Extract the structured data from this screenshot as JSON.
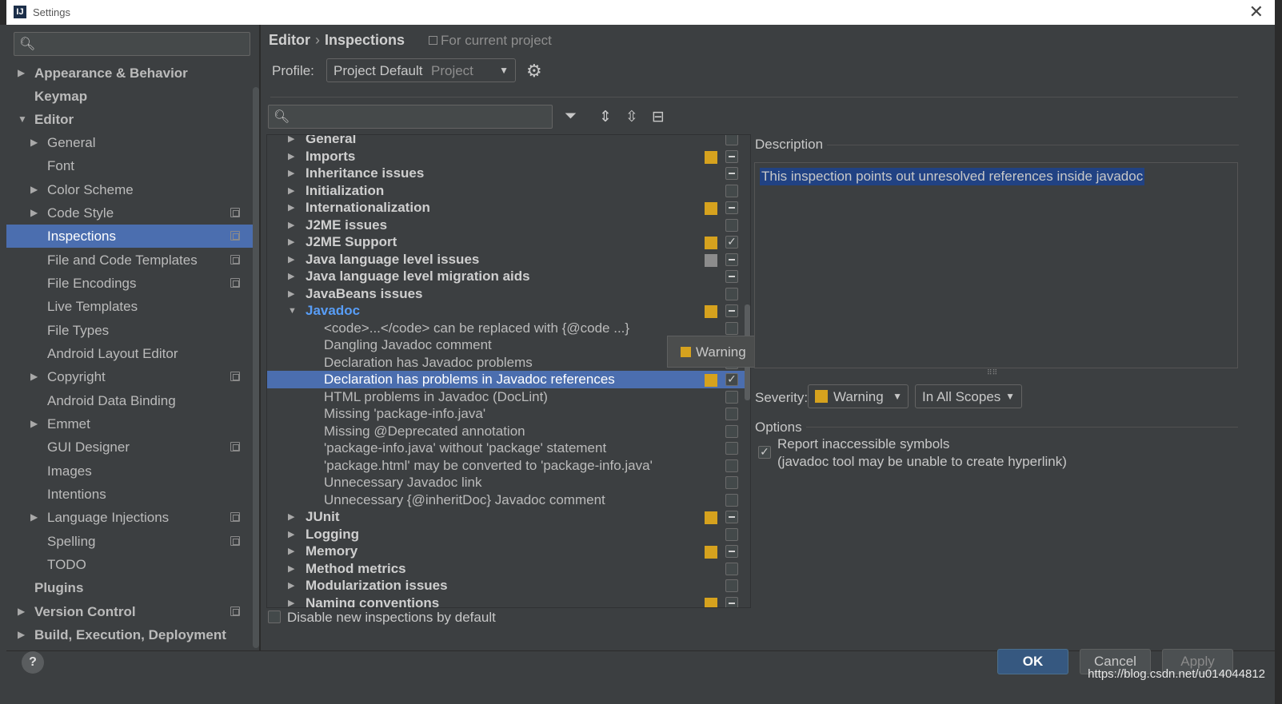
{
  "window": {
    "title": "Settings"
  },
  "sidebar": {
    "items": [
      {
        "label": "Appearance & Behavior",
        "arrow": "▶"
      },
      {
        "label": "Keymap",
        "arrow": ""
      },
      {
        "label": "Editor",
        "arrow": "▼"
      },
      {
        "label": "General",
        "arrow": "▶"
      },
      {
        "label": "Font",
        "arrow": ""
      },
      {
        "label": "Color Scheme",
        "arrow": "▶"
      },
      {
        "label": "Code Style",
        "arrow": "▶"
      },
      {
        "label": "Inspections",
        "arrow": ""
      },
      {
        "label": "File and Code Templates",
        "arrow": ""
      },
      {
        "label": "File Encodings",
        "arrow": ""
      },
      {
        "label": "Live Templates",
        "arrow": ""
      },
      {
        "label": "File Types",
        "arrow": ""
      },
      {
        "label": "Android Layout Editor",
        "arrow": ""
      },
      {
        "label": "Copyright",
        "arrow": "▶"
      },
      {
        "label": "Android Data Binding",
        "arrow": ""
      },
      {
        "label": "Emmet",
        "arrow": "▶"
      },
      {
        "label": "GUI Designer",
        "arrow": ""
      },
      {
        "label": "Images",
        "arrow": ""
      },
      {
        "label": "Intentions",
        "arrow": ""
      },
      {
        "label": "Language Injections",
        "arrow": "▶"
      },
      {
        "label": "Spelling",
        "arrow": ""
      },
      {
        "label": "TODO",
        "arrow": ""
      },
      {
        "label": "Plugins",
        "arrow": ""
      },
      {
        "label": "Version Control",
        "arrow": "▶"
      },
      {
        "label": "Build, Execution, Deployment",
        "arrow": "▶"
      }
    ]
  },
  "breadcrumb": {
    "parent": "Editor",
    "separator": "›",
    "current": "Inspections",
    "scope_note": "For current project"
  },
  "profile": {
    "label": "Profile:",
    "value": "Project Default",
    "type": "Project"
  },
  "inspections": {
    "rows": [
      {
        "label": "General",
        "arrow": "▶",
        "severity": "",
        "check": ""
      },
      {
        "label": "Imports",
        "arrow": "▶",
        "severity": "warn",
        "check": "mixed"
      },
      {
        "label": "Inheritance issues",
        "arrow": "▶",
        "severity": "",
        "check": "mixed"
      },
      {
        "label": "Initialization",
        "arrow": "▶",
        "severity": "",
        "check": ""
      },
      {
        "label": "Internationalization",
        "arrow": "▶",
        "severity": "warn",
        "check": "mixed"
      },
      {
        "label": "J2ME issues",
        "arrow": "▶",
        "severity": "",
        "check": ""
      },
      {
        "label": "J2ME Support",
        "arrow": "▶",
        "severity": "warn",
        "check": "checked"
      },
      {
        "label": "Java language level issues",
        "arrow": "▶",
        "severity": "gray",
        "check": "mixed"
      },
      {
        "label": "Java language level migration aids",
        "arrow": "▶",
        "severity": "",
        "check": "mixed"
      },
      {
        "label": "JavaBeans issues",
        "arrow": "▶",
        "severity": "",
        "check": ""
      },
      {
        "label": "Javadoc",
        "arrow": "▼",
        "severity": "warn",
        "check": "mixed"
      },
      {
        "label": "<code>...</code> can be replaced with {@code ...}",
        "severity": "",
        "check": ""
      },
      {
        "label": "Dangling Javadoc comment",
        "severity": "",
        "check": ""
      },
      {
        "label": "Declaration has Javadoc problems",
        "severity": "",
        "check": ""
      },
      {
        "label": "Declaration has problems in Javadoc references",
        "severity": "warn",
        "check": "checked"
      },
      {
        "label": "HTML problems in Javadoc (DocLint)",
        "severity": "",
        "check": ""
      },
      {
        "label": "Missing 'package-info.java'",
        "severity": "",
        "check": ""
      },
      {
        "label": "Missing @Deprecated annotation",
        "severity": "",
        "check": ""
      },
      {
        "label": "'package-info.java' without 'package' statement",
        "severity": "",
        "check": ""
      },
      {
        "label": "'package.html' may be converted to 'package-info.java'",
        "severity": "",
        "check": ""
      },
      {
        "label": "Unnecessary Javadoc link",
        "severity": "",
        "check": ""
      },
      {
        "label": "Unnecessary {@inheritDoc} Javadoc comment",
        "severity": "",
        "check": ""
      },
      {
        "label": "JUnit",
        "arrow": "▶",
        "severity": "warn",
        "check": "mixed"
      },
      {
        "label": "Logging",
        "arrow": "▶",
        "severity": "",
        "check": ""
      },
      {
        "label": "Memory",
        "arrow": "▶",
        "severity": "warn",
        "check": "mixed"
      },
      {
        "label": "Method metrics",
        "arrow": "▶",
        "severity": "",
        "check": ""
      },
      {
        "label": "Modularization issues",
        "arrow": "▶",
        "severity": "",
        "check": ""
      },
      {
        "label": "Naming conventions",
        "arrow": "▶",
        "severity": "warn",
        "check": "mixed"
      }
    ],
    "tooltip": "Warning",
    "disable_label": "Disable new inspections by default"
  },
  "description": {
    "title": "Description",
    "text": "This inspection points out unresolved references inside javadoc"
  },
  "severity": {
    "label": "Severity:",
    "value": "Warning",
    "scope": "In All Scopes"
  },
  "options": {
    "title": "Options",
    "line1": "Report inaccessible symbols",
    "line2": "(javadoc tool may be unable to create hyperlink)"
  },
  "footer": {
    "help": "?",
    "ok": "OK",
    "cancel": "Cancel",
    "apply": "Apply",
    "watermark": "https://blog.csdn.net/u014044812"
  },
  "colors": {
    "selection": "#4b6eaf",
    "warning": "#d6a21e",
    "link": "#589df6"
  }
}
